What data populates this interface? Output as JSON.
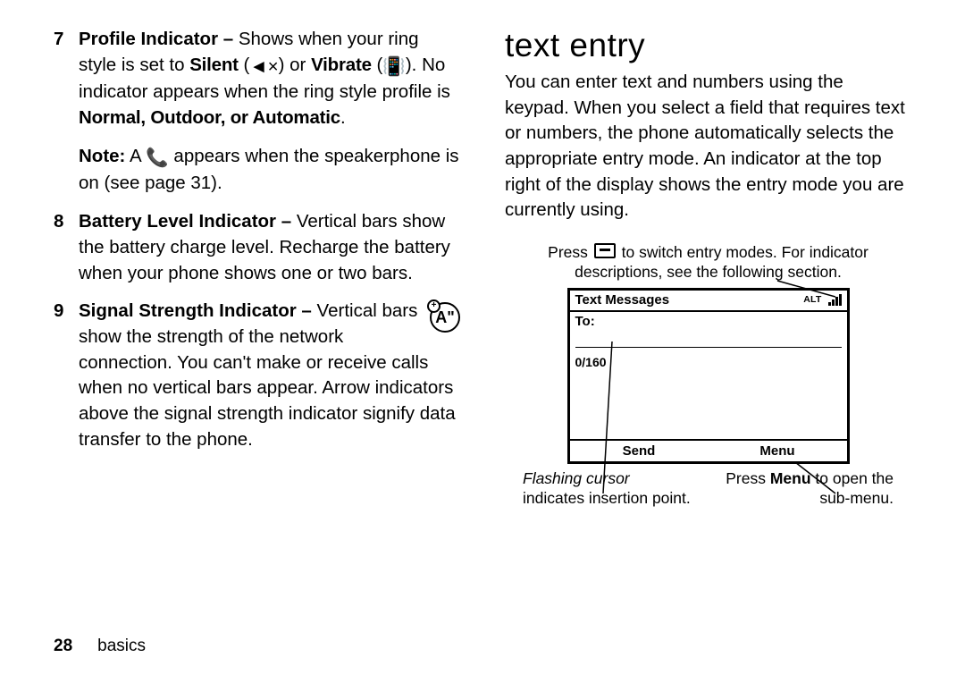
{
  "left": {
    "items": [
      {
        "num": "7",
        "title": "Profile Indicator –",
        "text_pre": " Shows when your ring style is set to ",
        "silent_label": "Silent",
        "vibrate_label": "Vibrate",
        "text_mid1": " (",
        "silent_icon": "◄×",
        "text_mid2": ") or ",
        "vibrate_icon": "📳",
        "text_mid3": "). No indicator appears when the ring style profile is ",
        "profiles": "Normal, Outdoor, or Automatic",
        "text_end": ".",
        "note_label": "Note:",
        "note_text_1": " A ",
        "note_icon": "📞",
        "note_text_2": " appears when the speakerphone is on (see page 31)."
      },
      {
        "num": "8",
        "title": "Battery Level Indicator –",
        "text": " Vertical bars show the battery charge level. Recharge the battery when your phone shows one or two bars."
      },
      {
        "num": "9",
        "title": "Signal Strength Indicator –",
        "badge": "A\"",
        "text": "Vertical bars show the strength of the network connection. You can't make or receive calls when no vertical bars appear. Arrow indicators above the signal strength indicator signify data transfer to the phone."
      }
    ],
    "page_number": "28",
    "section_label": "basics"
  },
  "right": {
    "heading": "text entry",
    "paragraph": "You can enter text and numbers using the keypad. When you select a field that requires text or numbers, the phone automatically selects the appropriate entry mode. An indicator at the top right of the display shows the entry mode you are currently using.",
    "top_caption_1": "Press ",
    "top_caption_menu_key": "menu-key",
    "top_caption_2": " to switch entry modes. For indicator descriptions, see the following section.",
    "screen": {
      "title": "Text Messages",
      "alt_label": "ALT",
      "signal_icon": "signal-icon",
      "to_label": "To:",
      "counter": "0/160",
      "softkey_left": "Send",
      "softkey_right": "Menu"
    },
    "bottom_left_1": "Flashing cursor",
    "bottom_left_2": " indicates insertion point.",
    "bottom_right_1": "Press ",
    "bottom_right_bold": "Menu",
    "bottom_right_2": " to open the sub-menu."
  }
}
